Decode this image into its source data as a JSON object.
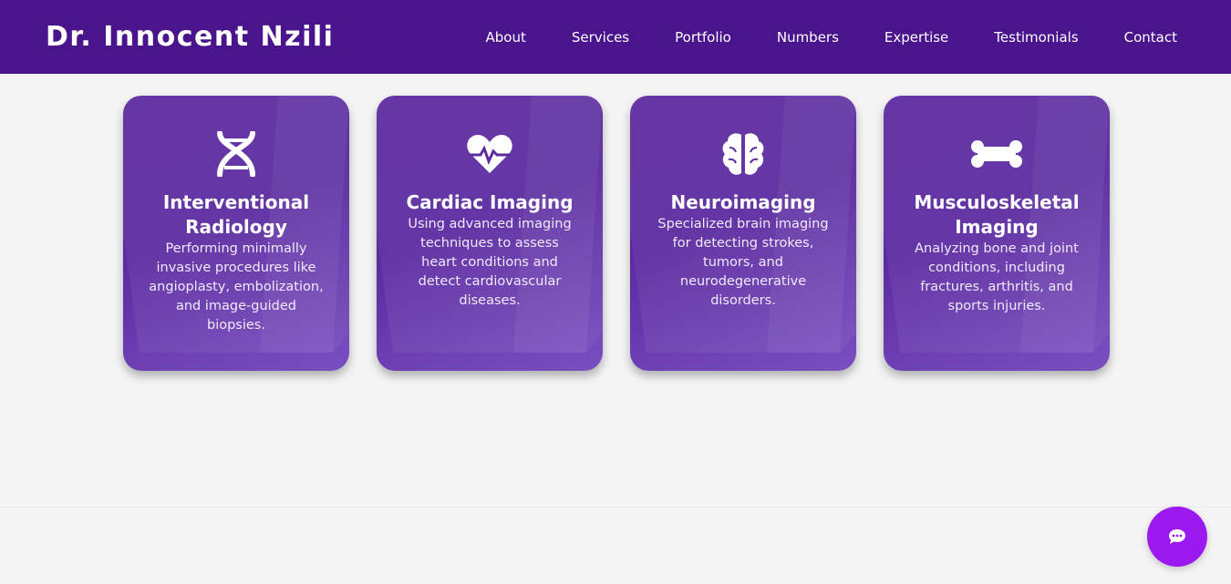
{
  "header": {
    "brand": "Dr. Innocent Nzili",
    "nav": [
      "About",
      "Services",
      "Portfolio",
      "Numbers",
      "Expertise",
      "Testimonials",
      "Contact"
    ]
  },
  "colors": {
    "header_bg": "#4a148c",
    "card_bg": "#5e2aa0",
    "chat_button": "#9b19f0",
    "page_bg": "#f4f4f4"
  },
  "services": [
    {
      "icon": "dna-icon",
      "title": "Interventional Radiology",
      "description": "Performing minimally invasive procedures like angioplasty, embolization, and image-guided biopsies."
    },
    {
      "icon": "heart-pulse-icon",
      "title": "Cardiac Imaging",
      "description": "Using advanced imaging techniques to assess heart conditions and detect cardiovascular diseases."
    },
    {
      "icon": "brain-icon",
      "title": "Neuroimaging",
      "description": "Specialized brain imaging for detecting strokes, tumors, and neurodegenerative disorders."
    },
    {
      "icon": "bone-icon",
      "title": "Musculoskeletal Imaging",
      "description": "Analyzing bone and joint conditions, including fractures, arthritis, and sports injuries."
    }
  ],
  "chat": {
    "icon": "chat-bubble-icon"
  }
}
